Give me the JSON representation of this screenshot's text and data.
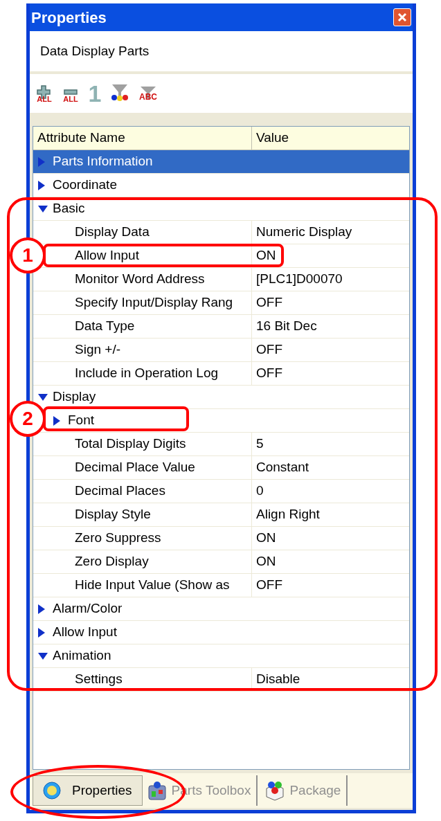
{
  "window": {
    "title": "Properties"
  },
  "subtitle": "Data Display Parts",
  "toolbar": [
    {
      "kind": "expand-all",
      "label": "ALL"
    },
    {
      "kind": "collapse-all",
      "label": "ALL"
    },
    {
      "kind": "number",
      "label": "1"
    },
    {
      "kind": "filter-color"
    },
    {
      "kind": "filter-text",
      "label": "ABC"
    }
  ],
  "table": {
    "columns": [
      "Attribute Name",
      "Value"
    ],
    "rows": [
      {
        "name": "Parts Information",
        "expanded": false,
        "selected": true
      },
      {
        "name": "Coordinate",
        "expanded": false,
        "selected": false
      },
      {
        "name": "Basic",
        "expanded": true,
        "selected": false,
        "children": [
          {
            "name": "Display Data",
            "value": "Numeric Display",
            "selected": false
          },
          {
            "name": "Allow Input",
            "value": "ON",
            "selected": false
          },
          {
            "name": "Monitor Word Address",
            "value": "[PLC1]D00070",
            "selected": false
          },
          {
            "name": "Specify Input/Display Rang",
            "value": "OFF",
            "selected": false
          },
          {
            "name": "Data Type",
            "value": "16 Bit Dec",
            "selected": false
          },
          {
            "name": "Sign +/-",
            "value": "OFF",
            "selected": false
          },
          {
            "name": "Include in Operation Log",
            "value": "OFF",
            "selected": false
          }
        ]
      },
      {
        "name": "Display",
        "expanded": true,
        "selected": false,
        "children": [
          {
            "name": "Font",
            "expanded": false,
            "selected": false
          },
          {
            "name": "Total Display Digits",
            "value": "5",
            "selected": false
          },
          {
            "name": "Decimal Place Value",
            "value": "Constant",
            "selected": false
          },
          {
            "name": "Decimal Places",
            "value": "0",
            "selected": false
          },
          {
            "name": "Display Style",
            "value": "Align Right",
            "selected": false
          },
          {
            "name": "Zero Suppress",
            "value": "ON",
            "selected": false
          },
          {
            "name": "Zero Display",
            "value": "ON",
            "selected": false
          },
          {
            "name": "Hide Input Value (Show as",
            "value": "OFF",
            "selected": false
          }
        ]
      },
      {
        "name": "Alarm/Color",
        "expanded": false,
        "selected": false
      },
      {
        "name": "Allow Input",
        "expanded": false,
        "selected": false
      },
      {
        "name": "Animation",
        "expanded": true,
        "selected": false,
        "children": [
          {
            "name": "Settings",
            "value": "Disable",
            "selected": false
          }
        ]
      }
    ]
  },
  "tabs": [
    {
      "label": "Properties",
      "selected": true
    },
    {
      "label": "Parts Toolbox",
      "selected": false
    },
    {
      "label": "Package",
      "selected": false
    }
  ],
  "callouts": [
    {
      "label": "1"
    },
    {
      "label": "2"
    }
  ]
}
